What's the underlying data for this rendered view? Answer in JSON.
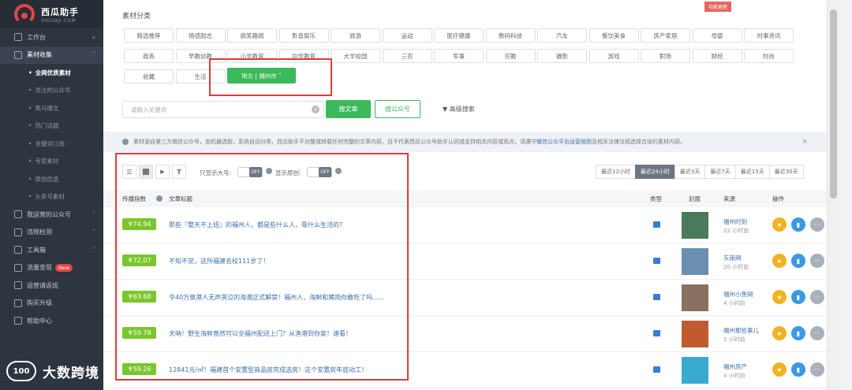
{
  "app": {
    "title": "西瓜助手",
    "subtitle": "XIGUAJI.COM"
  },
  "sidebar": {
    "items": [
      {
        "label": "工作台",
        "arrow": "«"
      },
      {
        "label": "素材收集",
        "arrow": "˄"
      },
      {
        "label": "我运营的公众号",
        "arrow": "˅"
      },
      {
        "label": "违规检测",
        "arrow": "˅"
      },
      {
        "label": "工具箱",
        "arrow": "˅"
      },
      {
        "label": "流量变现",
        "badge": "New"
      },
      {
        "label": "运营请返班"
      },
      {
        "label": "购买升级"
      },
      {
        "label": "帮助中心"
      }
    ],
    "subitems": [
      "全网优质素材",
      "关注的公众号",
      "隽马爆文",
      "热门话题",
      "关键词订阅",
      "专家素材",
      "原创优选",
      "头条号素材"
    ]
  },
  "category": {
    "title": "素材分类",
    "ribbon": "功能更新",
    "tags": [
      "精选推荐",
      "情感励志",
      "搞笑趣闻",
      "影音娱乐",
      "旅游",
      "运动",
      "医疗健康",
      "数码科技",
      "汽车",
      "餐饮美食",
      "房产家居",
      "母婴",
      "时事资讯",
      "政务",
      "早教幼教",
      "小学教育",
      "中学教育",
      "大学校园",
      "三农",
      "军事",
      "宗教",
      "摄影",
      "游戏",
      "职场",
      "财经",
      "时尚",
      "收藏",
      "生活"
    ],
    "region": "地方 | 福州市 ˅"
  },
  "search": {
    "placeholder": "请输入关键词",
    "btn_article": "搜文章",
    "btn_account": "搜公众号",
    "advanced": "▼ 高级搜索"
  },
  "notice": {
    "text_before": "素材源自第三方微信公众号，由机器选取，系统自动分类，西瓜助手不对整或转载任何完整的文章内容，且不代表西瓜公众号助手认同或支持相关内容或观点，请遵守",
    "link": "微信公众平台运营规则",
    "text_after": "及相关法律法规选择合适的素材内容。",
    "close": "×"
  },
  "filters": {
    "big_only": "只显示大号:",
    "original": "显示原创:",
    "off": "OFF",
    "time_tabs": [
      "最近12小时",
      "最近24小时",
      "最近3天",
      "最近7天",
      "最近15天",
      "最近30天"
    ],
    "active_tab_index": 1
  },
  "table": {
    "headers": {
      "index": "传播指数",
      "title": "文章标题",
      "type": "类型",
      "cover": "封面",
      "source": "来源",
      "op": "操作"
    },
    "rows": [
      {
        "score": "74.94",
        "title": "那些『整天不上班』的福州人，都是些什么人，靠什么生活的？",
        "source": "福州时刻",
        "time": "22 小时前",
        "cover_color": "#4a7a5a"
      },
      {
        "score": "72.07",
        "title": "不知不觉，这所福建名校111岁了！",
        "source": "东南网",
        "time": "20 小时前",
        "cover_color": "#6a8fb0"
      },
      {
        "score": "63.68",
        "title": "令40万泉港人无声哭泣的海潮正式解禁！福州人，海鲜和猪肉你敢吃了吗......",
        "source": "福州小鱼网",
        "time": "4 小时前",
        "cover_color": "#8a7060"
      },
      {
        "score": "59.78",
        "title": "天呐！野生海鲜竟然可以全福州配送上门？从渔港到你家！速看！",
        "source": "福州那些事儿",
        "time": "5 小时前",
        "cover_color": "#c05a30"
      },
      {
        "score": "59.26",
        "title": "12841元/㎡！福建首个安置型商品房完成选房！这个安置房年底动工！",
        "source": "福州房产",
        "time": "4 小时前",
        "cover_color": "#3aaad0"
      }
    ]
  },
  "watermark": {
    "logo": "100",
    "text": "大数跨境"
  },
  "colors": {
    "accent": "#3cb95a",
    "score": "#7cc62d",
    "sidebar": "#2d3540",
    "highlight": "#e23a3a"
  }
}
